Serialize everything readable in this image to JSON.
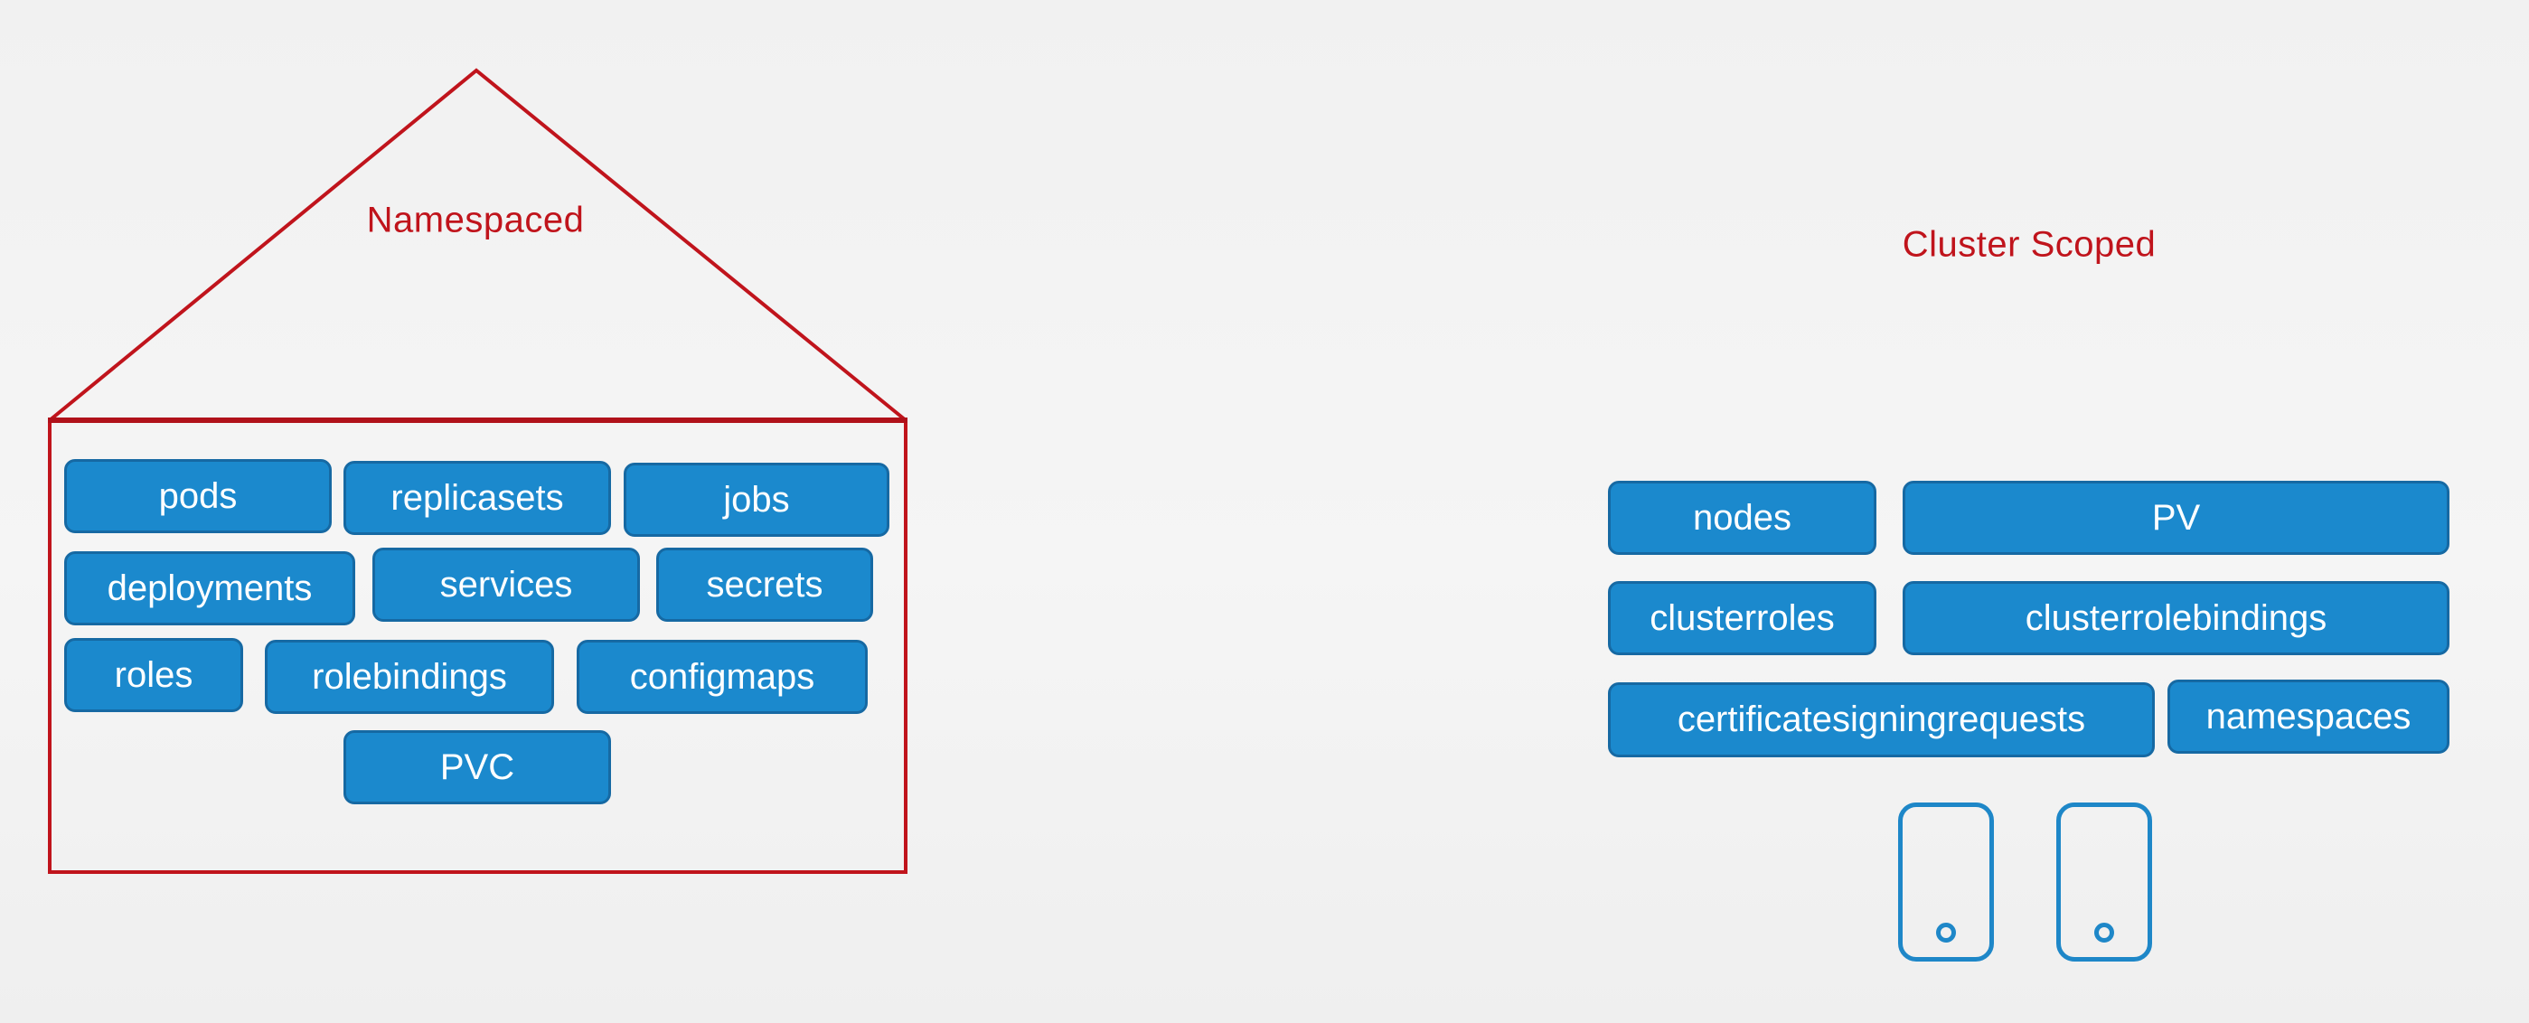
{
  "namespaced": {
    "title": "Namespaced",
    "resources": [
      "pods",
      "replicasets",
      "jobs",
      "deployments",
      "services",
      "secrets",
      "roles",
      "rolebindings",
      "configmaps",
      "PVC"
    ]
  },
  "cluster_scoped": {
    "title": "Cluster Scoped",
    "resources": [
      "nodes",
      "PV",
      "clusterroles",
      "clusterrolebindings",
      "certificatesigningrequests",
      "namespaces"
    ]
  },
  "icons": [
    "node-device-icon",
    "node-device-icon"
  ],
  "colors": {
    "accent_red": "#c0141c",
    "resource_fill": "#1b89cd",
    "resource_border": "#1669a3",
    "device_stroke": "#1e87c8"
  }
}
